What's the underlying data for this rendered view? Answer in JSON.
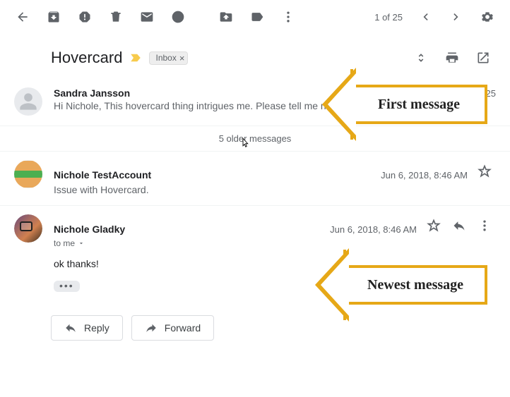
{
  "toolbar": {
    "pagination": "1 of 25"
  },
  "subject": {
    "title": "Hovercard",
    "label": "Inbox"
  },
  "messages": {
    "first": {
      "sender": "Sandra Jansson",
      "date": "Jun 5, 2018, 4:25",
      "preview": "Hi Nichole, This hovercard thing intrigues me. Please tell me n"
    },
    "older_link": "5 older messages",
    "second": {
      "sender": "Nichole TestAccount",
      "date": "Jun 6, 2018, 8:46 AM",
      "preview": "Issue with Hovercard."
    },
    "third": {
      "sender": "Nichole Gladky",
      "date": "Jun 6, 2018, 8:46 AM",
      "to": "to me",
      "body": "ok thanks!"
    }
  },
  "actions": {
    "reply": "Reply",
    "forward": "Forward"
  },
  "annotations": {
    "first": "First message",
    "newest": "Newest message"
  }
}
